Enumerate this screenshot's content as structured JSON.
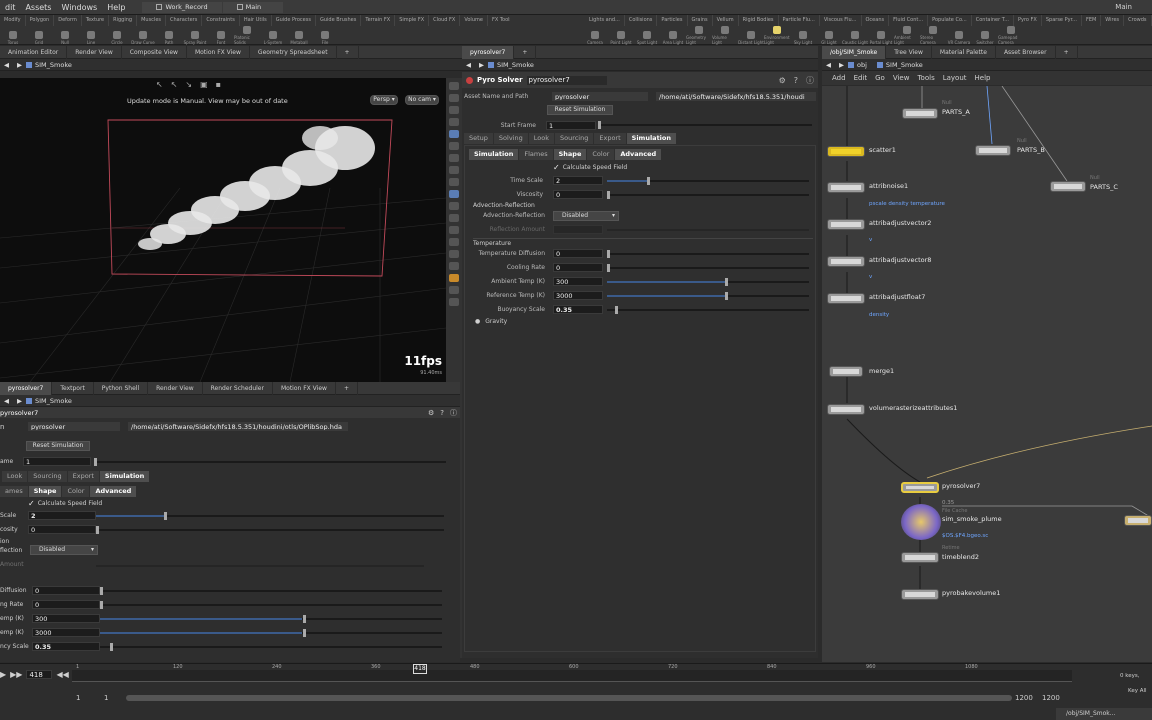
{
  "menubar": {
    "items": [
      "dit",
      "Assets",
      "Windows",
      "Help"
    ],
    "desktop_tabs": [
      "Work_Record",
      "Main"
    ],
    "right_label": "Main"
  },
  "shelf": {
    "left_tabs": [
      "Modify",
      "Polygon",
      "Deform",
      "Texture",
      "Rigging",
      "Muscles",
      "Characters",
      "Constraints",
      "Hair Utils",
      "Guide Process",
      "Guide Brushes",
      "Terrain FX",
      "Simple FX",
      "Cloud FX",
      "Volume",
      "FX Tools"
    ],
    "left_tools": [
      "Torus",
      "Grid",
      "Null",
      "Line",
      "Circle",
      "Draw Curve",
      "Path",
      "Spray Paint",
      "Font",
      "Platonic Solids",
      "L-System",
      "Metaball",
      "File"
    ],
    "right_tabs": [
      "Lights and...",
      "Collisions",
      "Particles",
      "Grains",
      "Vellum",
      "Rigid Bodies",
      "Particle Flu...",
      "Viscous Flu...",
      "Oceans",
      "Fluid Cont...",
      "Populate Co...",
      "Container T...",
      "Pyro FX",
      "Sparse Pyr...",
      "FEM",
      "Wires",
      "Crowds"
    ],
    "right_tools": [
      "Camera",
      "Point Light",
      "Spot Light",
      "Area Light",
      "Geometry Light",
      "Volume Light",
      "Distant Light",
      "Environment Light",
      "Sky Light",
      "GI Light",
      "Caustic Light",
      "Portal Light",
      "Ambient Light",
      "Stereo Camera",
      "VR Camera",
      "Switcher",
      "Gamepad Camera"
    ]
  },
  "left_panetabs": [
    "Animation Editor",
    "Render View",
    "Composite View",
    "Motion FX View",
    "Geometry Spreadsheet"
  ],
  "viewport": {
    "path": "SIM_Smoke",
    "message": "Update mode is Manual. View may be out of date",
    "persp": "Persp",
    "cam": "No cam",
    "fps": "11fps",
    "ms": "91.40ms"
  },
  "parm": {
    "tab": "pyrosolver7",
    "path": "SIM_Smoke",
    "node_type": "Pyro Solver",
    "node_name": "pyrosolver7",
    "asset_label": "Asset Name and Path",
    "asset_name": "pyrosolver",
    "asset_path": "/home/ati/Software/Sidefx/hfs18.5.351/houdi",
    "reset": "Reset Simulation",
    "start_frame_label": "Start Frame",
    "start_frame": "1",
    "tabs": [
      "Setup",
      "Solving",
      "Look",
      "Sourcing",
      "Export",
      "Simulation"
    ],
    "subtabs": [
      "Simulation",
      "Flames",
      "Shape",
      "Color",
      "Advanced"
    ],
    "calc_speed": "Calculate Speed Field",
    "time_scale_label": "Time Scale",
    "time_scale": "2",
    "viscosity_label": "Viscosity",
    "viscosity": "0",
    "adv_ref_header": "Advection-Reflection",
    "adv_ref_label": "Advection-Reflection",
    "adv_ref_value": "Disabled",
    "ref_amount_label": "Reflection Amount",
    "temp_header": "Temperature",
    "temp_diff_label": "Temperature Diffusion",
    "temp_diff": "0",
    "cooling_label": "Cooling Rate",
    "cooling": "0",
    "ambient_label": "Ambient Temp (K)",
    "ambient": "300",
    "reference_label": "Reference Temp (K)",
    "reference": "3000",
    "buoyancy_label": "Buoyancy Scale",
    "buoyancy": "0.35",
    "gravity_label": "Gravity"
  },
  "lower": {
    "panetabs": [
      "pyrosolver7",
      "Textport",
      "Python Shell",
      "Render View",
      "Render Scheduler",
      "Motion FX View"
    ],
    "path": "SIM_Smoke",
    "node_name": "pyrosolver7",
    "asset_label": "n",
    "asset_name": "pyrosolver",
    "asset_path": "/home/ati/Software/Sidefx/hfs18.5.351/houdini/otls/OPlibSop.hda",
    "reset": "Reset Simulation",
    "frame_label": "ame",
    "frame_value": "1",
    "tabs": [
      "Look",
      "Sourcing",
      "Export",
      "Simulation"
    ],
    "subtabs": [
      "ames",
      "Shape",
      "Color",
      "Advanced"
    ],
    "calc_speed": "Calculate Speed Field",
    "time_scale_label": "Scale",
    "time_scale": "2",
    "visc_label": "cosity",
    "visc": "0",
    "adv1": "ion",
    "adv2": "flection",
    "adv_value": "Disabled",
    "ref_amount": "Amount",
    "diff_label": "Diffusion",
    "diff": "0",
    "rate_label": "ng Rate",
    "rate": "0",
    "amb_label": "emp (K)",
    "amb": "300",
    "ref_label": "emp (K)",
    "ref": "3000",
    "buoy_label": "ncy Scale",
    "buoy": "0.35"
  },
  "network": {
    "panetabs": [
      "/obj/SIM_Smoke",
      "Tree View",
      "Material Palette",
      "Asset Browser"
    ],
    "path": "SIM_Smoke",
    "path_root": "obj",
    "menu": [
      "Add",
      "Edit",
      "Go",
      "View",
      "Tools",
      "Layout",
      "Help"
    ],
    "nodes": {
      "parts_a": "PARTS_A",
      "parts_b": "PARTS_B",
      "parts_c": "PARTS_C",
      "null_tag": "Null",
      "scatter": "scatter1",
      "noise": "attribnoise1",
      "noise_sub": "pscale density temperature",
      "vec2": "attribadjustvector2",
      "vec2_sub": "v",
      "vec8": "attribadjustvector8",
      "vec8_sub": "v",
      "float7": "attribadjustfloat7",
      "float7_sub": "density",
      "merge": "merge1",
      "raster": "volumerasterizeattributes1",
      "pyro": "pyrosolver7",
      "pyro_sub": "0.35",
      "cache": "sim_smoke_plume",
      "cache_tag": "File Cache",
      "cache_sub": "$OS.$F4.bgeo.sc",
      "timeblend": "timeblend2",
      "timeblend_tag": "Retime",
      "bake": "pyrobakevolume1"
    }
  },
  "timeline": {
    "frame": "418",
    "ticks": [
      "1",
      "120",
      "240",
      "360",
      "418",
      "480",
      "600",
      "720",
      "840",
      "960",
      "1080"
    ],
    "start": "1",
    "start2": "1",
    "end": "1200",
    "end2": "1200",
    "keys": "0 keys,",
    "keyall": "Key All",
    "status": "/obj/SIM_Smok..."
  }
}
